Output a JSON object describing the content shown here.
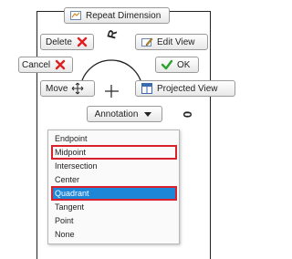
{
  "toolbar": {
    "repeat_dimension": "Repeat Dimension",
    "delete": "Delete",
    "edit_view": "Edit View",
    "cancel": "Cancel",
    "ok": "OK",
    "move": "Move",
    "projected_view": "Projected View",
    "annotation": "Annotation"
  },
  "drawing": {
    "label_top": "R",
    "label_side": "0"
  },
  "snap_menu": {
    "items": [
      "Endpoint",
      "Midpoint",
      "Intersection",
      "Center",
      "Quadrant",
      "Tangent",
      "Point",
      "None"
    ],
    "selected": "Quadrant",
    "highlighted": [
      "Midpoint",
      "Quadrant"
    ]
  },
  "colors": {
    "selection": "#1e86d6",
    "highlight_box": "#d8212c",
    "delete_icon": "#e02020",
    "ok_icon": "#2ea02e"
  }
}
